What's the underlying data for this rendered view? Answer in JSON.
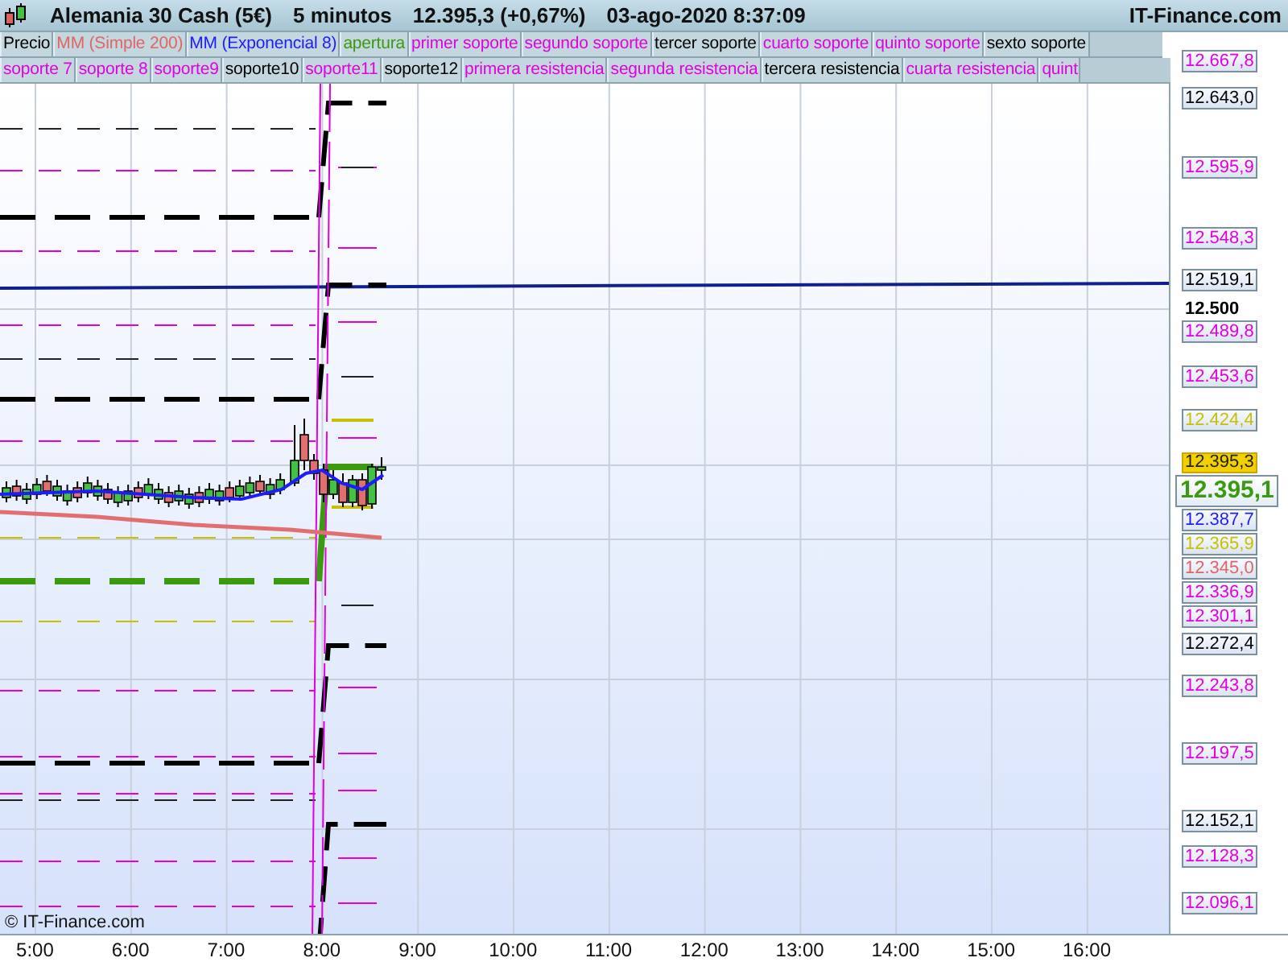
{
  "header": {
    "instrument": "Alemania 30 Cash (5€)",
    "interval": "5 minutos",
    "price": "12.395,3 (+0,67%)",
    "datetime": "03-ago-2020 8:37:09",
    "site": "IT-Finance.com"
  },
  "legend_rows": [
    [
      {
        "label": "Precio",
        "color": "#000000"
      },
      {
        "label": "MM (Simple 200)",
        "color": "#e06666"
      },
      {
        "label": "MM (Exponencial 8)",
        "color": "#1c1cff"
      },
      {
        "label": "apertura",
        "color": "#3c9a10"
      },
      {
        "label": "primer soporte",
        "color": "#e000e0"
      },
      {
        "label": "segundo soporte",
        "color": "#e000e0"
      },
      {
        "label": "tercer soporte",
        "color": "#000000"
      },
      {
        "label": "cuarto soporte",
        "color": "#e000e0"
      },
      {
        "label": "quinto soporte",
        "color": "#e000e0"
      },
      {
        "label": "sexto soporte",
        "color": "#000000"
      }
    ],
    [
      {
        "label": "soporte 7",
        "color": "#e000e0"
      },
      {
        "label": "soporte 8",
        "color": "#e000e0"
      },
      {
        "label": "soporte9",
        "color": "#e000e0"
      },
      {
        "label": "soporte10",
        "color": "#000000"
      },
      {
        "label": "soporte11",
        "color": "#e000e0"
      },
      {
        "label": "soporte12",
        "color": "#000000"
      },
      {
        "label": "primera resistencia",
        "color": "#e000e0"
      },
      {
        "label": "segunda resistencia",
        "color": "#e000e0"
      },
      {
        "label": "tercera resistencia",
        "color": "#000000"
      },
      {
        "label": "cuarta resistencia",
        "color": "#e000e0"
      },
      {
        "label": "quint",
        "color": "#e000e0"
      }
    ]
  ],
  "price_axis": [
    {
      "text": "12.667,8",
      "color": "#e000e0",
      "kind": "label"
    },
    {
      "text": "12.643,0",
      "color": "#000000",
      "kind": "label"
    },
    {
      "text": "12.595,9",
      "color": "#e000e0",
      "kind": "label"
    },
    {
      "text": "12.548,3",
      "color": "#e000e0",
      "kind": "label"
    },
    {
      "text": "12.519,1",
      "color": "#000000",
      "kind": "label"
    },
    {
      "text": "12.500",
      "color": "#000000",
      "kind": "tick"
    },
    {
      "text": "12.489,8",
      "color": "#e000e0",
      "kind": "label"
    },
    {
      "text": "12.453,6",
      "color": "#e000e0",
      "kind": "label"
    },
    {
      "text": "12.424,4",
      "color": "#c8c000",
      "kind": "label"
    },
    {
      "text": "12.395,3",
      "color": "#f2d000",
      "kind": "filled"
    },
    {
      "text": "12.395,1",
      "color": "#3c9a10",
      "kind": "last"
    },
    {
      "text": "12.387,7",
      "color": "#1c1cff",
      "kind": "label"
    },
    {
      "text": "12.365,9",
      "color": "#c8c000",
      "kind": "label"
    },
    {
      "text": "12.345,0",
      "color": "#e06666",
      "kind": "label"
    },
    {
      "text": "12.336,9",
      "color": "#e000e0",
      "kind": "label"
    },
    {
      "text": "12.301,1",
      "color": "#e000e0",
      "kind": "label"
    },
    {
      "text": "12.272,4",
      "color": "#000000",
      "kind": "label"
    },
    {
      "text": "12.243,8",
      "color": "#e000e0",
      "kind": "label"
    },
    {
      "text": "12.197,5",
      "color": "#e000e0",
      "kind": "label"
    },
    {
      "text": "12.152,1",
      "color": "#000000",
      "kind": "label"
    },
    {
      "text": "12.128,3",
      "color": "#e000e0",
      "kind": "label"
    },
    {
      "text": "12.096,1",
      "color": "#e000e0",
      "kind": "label"
    }
  ],
  "time_axis": [
    "5:00",
    "6:00",
    "7:00",
    "8:00",
    "9:00",
    "10:00",
    "11:00",
    "12:00",
    "13:00",
    "14:00",
    "15:00",
    "16:00"
  ],
  "copyright": "© IT-Finance.com"
}
